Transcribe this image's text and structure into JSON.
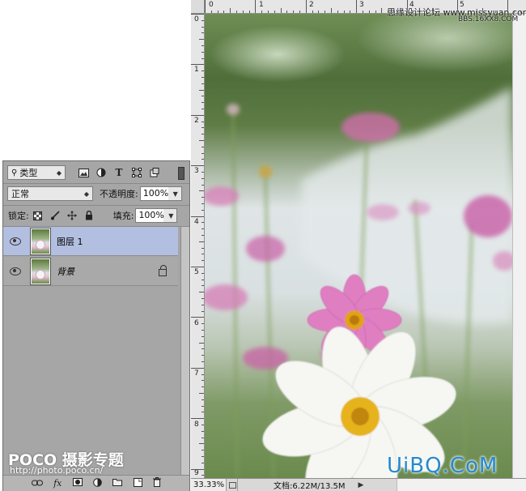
{
  "layers_panel": {
    "filter": {
      "selected": "类型",
      "search_icon": "search-icon"
    },
    "filter_icons": [
      "image-filter-icon",
      "adjustment-filter-icon",
      "type-filter-icon",
      "shape-filter-icon",
      "smart-object-filter-icon"
    ],
    "type_icon_glyph": "T",
    "blend_mode": "正常",
    "opacity_label": "不透明度:",
    "opacity_value": "100%",
    "lock_label": "锁定:",
    "fill_label": "填充:",
    "fill_value": "100%",
    "layers": [
      {
        "name": "图层 1",
        "visible": true,
        "selected": true
      },
      {
        "name": "背景",
        "visible": true,
        "selected": false,
        "locked": true
      }
    ],
    "footer_icons": [
      "link-icon",
      "fx-icon",
      "mask-icon",
      "adjustment-icon",
      "group-folder-icon",
      "new-layer-icon",
      "trash-icon"
    ],
    "fx_label": "fx"
  },
  "document": {
    "ruler_top_labels": [
      "0",
      "1",
      "2",
      "3",
      "4",
      "5"
    ],
    "ruler_left_labels": [
      "0",
      "1",
      "2",
      "3",
      "4",
      "5",
      "6",
      "7",
      "8",
      "9"
    ],
    "zoom": "33.33%",
    "doc_size": "文档:6.22M/13.5M"
  },
  "watermarks": {
    "site": "思缘设计论坛 www.missyuan.com",
    "url": "BBS.16XX8.COM",
    "uibq": "UiBQ.CoM",
    "poco": "POCO 摄影专题",
    "poco_url": "http://photo.poco.cn/"
  },
  "colors": {
    "panel_bg": "#a6a6a6",
    "selected_layer": "#b3bfe0",
    "watermark_blue": "#2489d0"
  }
}
